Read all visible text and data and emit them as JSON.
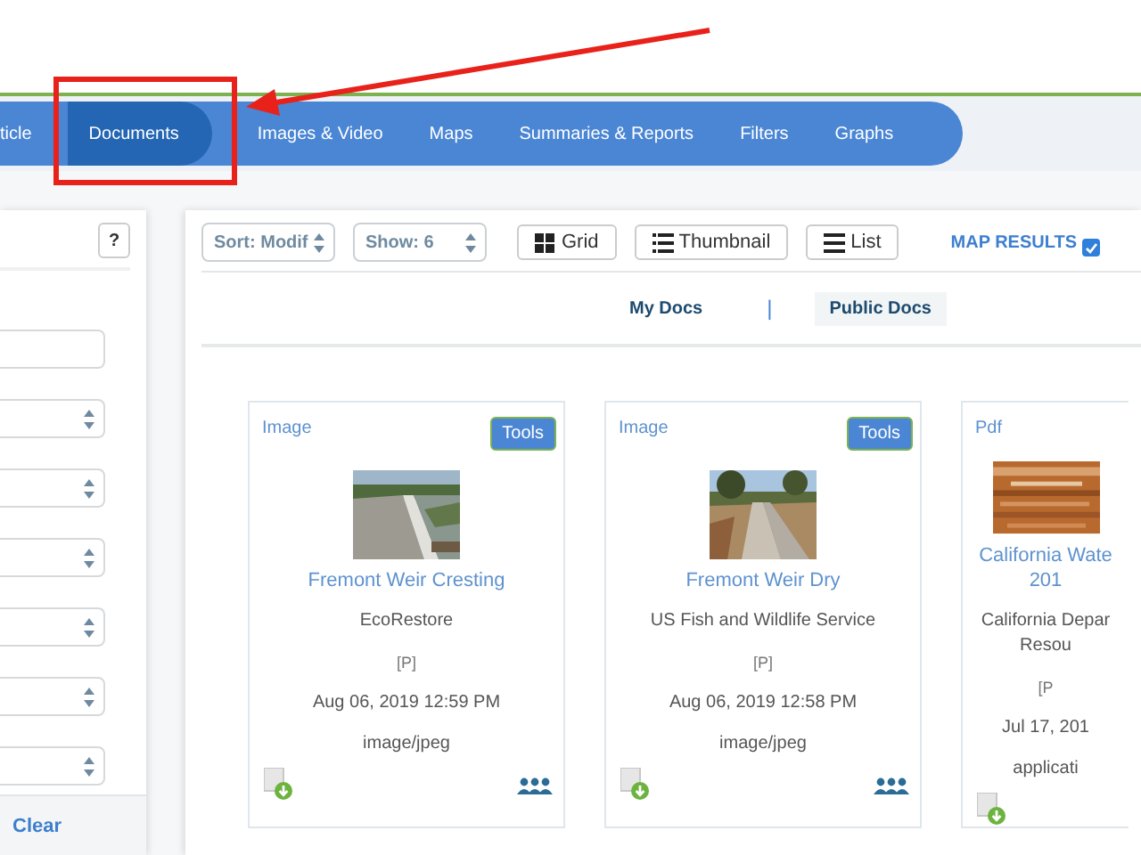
{
  "nav_tabs": [
    {
      "label": "ticle",
      "selected": false
    },
    {
      "label": "Documents",
      "selected": true
    },
    {
      "label": "Images & Video",
      "selected": false
    },
    {
      "label": "Maps",
      "selected": false
    },
    {
      "label": "Summaries & Reports",
      "selected": false
    },
    {
      "label": "Filters",
      "selected": false
    },
    {
      "label": "Graphs",
      "selected": false
    }
  ],
  "filter_panel": {
    "help": "?",
    "fields": [
      {
        "kind": "input"
      },
      {
        "kind": "select"
      },
      {
        "kind": "select"
      },
      {
        "kind": "select"
      },
      {
        "kind": "select"
      },
      {
        "kind": "select"
      },
      {
        "kind": "select"
      }
    ],
    "clear": "Clear"
  },
  "toolbar": {
    "sort": "Sort: Modif",
    "show": "Show: 6",
    "views": [
      {
        "label": "Grid",
        "kind": "grid"
      },
      {
        "label": "Thumbnail",
        "kind": "thumbnail"
      },
      {
        "label": "List",
        "kind": "list"
      }
    ],
    "map_results": {
      "label": "MAP RESULTS",
      "checked": true
    }
  },
  "doc_tabs": [
    {
      "label": "My Docs",
      "selected": false
    },
    {
      "label": "Public Docs",
      "selected": true
    }
  ],
  "doc_tab_separator": "|",
  "cards": [
    {
      "type": "Image",
      "tools": "Tools",
      "title": "Fremont Weir Cresting",
      "source": "EcoRestore",
      "access": "[P]",
      "date": "Aug 06, 2019 12:59 PM",
      "mime": "image/jpeg",
      "shared": true
    },
    {
      "type": "Image",
      "tools": "Tools",
      "title": "Fremont Weir Dry",
      "source": "US Fish and Wildlife Service",
      "access": "[P]",
      "date": "Aug 06, 2019 12:58 PM",
      "mime": "image/jpeg",
      "shared": true
    },
    {
      "type": "Pdf",
      "title": "California Wate 201",
      "source": "California Depar Resou",
      "access": "[P",
      "date": "Jul 17, 201",
      "mime": "applicati",
      "shared": false
    }
  ]
}
